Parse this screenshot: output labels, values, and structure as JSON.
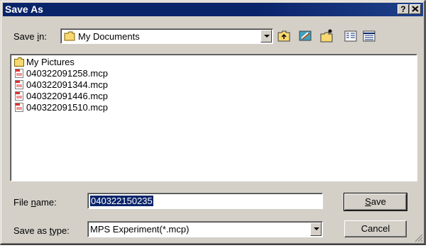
{
  "window": {
    "title": "Save As",
    "help_label": "?",
    "close_label": "✕"
  },
  "save_in": {
    "label_pre": "Save ",
    "label_accel": "i",
    "label_post": "n:",
    "value": "My Documents"
  },
  "toolbar": {
    "icons": [
      "up-folder-icon",
      "desktop-icon",
      "new-folder-icon",
      "list-view-icon",
      "details-view-icon"
    ]
  },
  "files": [
    {
      "name": "My Pictures",
      "type": "folder"
    },
    {
      "name": "040322091258.mcp",
      "type": "mcp"
    },
    {
      "name": "040322091344.mcp",
      "type": "mcp"
    },
    {
      "name": "040322091446.mcp",
      "type": "mcp"
    },
    {
      "name": "040322091510.mcp",
      "type": "mcp"
    }
  ],
  "file_name": {
    "label_pre": "File ",
    "label_accel": "n",
    "label_post": "ame:",
    "value": "040322150235"
  },
  "save_as_type": {
    "label_pre": "Save as ",
    "label_accel": "t",
    "label_post": "ype:",
    "value": "MPS Experiment(*.mcp)"
  },
  "buttons": {
    "save_accel": "S",
    "save_rest": "ave",
    "cancel": "Cancel"
  },
  "colors": {
    "title_bar": "#0a246a",
    "face": "#d4d0c8",
    "selection": "#0a246a"
  }
}
